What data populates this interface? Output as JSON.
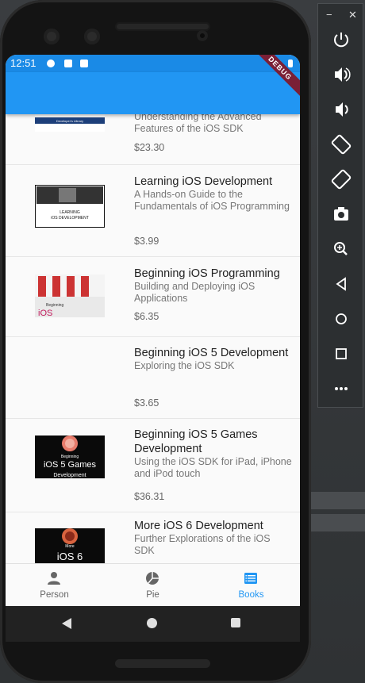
{
  "status": {
    "time": "12:51",
    "debug_label": "DEBUG"
  },
  "books": [
    {
      "title": "",
      "subtitle": "Understanding the Advanced Features of the iOS SDK",
      "price": "$23.30"
    },
    {
      "title": "Learning iOS Development",
      "subtitle": "A Hands-on Guide to the Fundamentals of iOS Programming",
      "price": "$3.99"
    },
    {
      "title": "Beginning iOS Programming",
      "subtitle": "Building and Deploying iOS Applications",
      "price": "$6.35"
    },
    {
      "title": "Beginning iOS 5 Development",
      "subtitle": "Exploring the iOS SDK",
      "price": "$3.65"
    },
    {
      "title": "Beginning iOS 5 Games Development",
      "subtitle": "Using the iOS SDK for iPad, iPhone and iPod touch",
      "price": "$36.31"
    },
    {
      "title": "More iOS 6 Development",
      "subtitle": "Further Explorations of the iOS SDK",
      "price": ""
    }
  ],
  "nav": {
    "person": "Person",
    "pie": "Pie",
    "books": "Books"
  },
  "colors": {
    "primary": "#2196f3",
    "statusbar": "#1a8ae6"
  },
  "toolbar": {
    "minimize": "−",
    "close": "✕",
    "icons": [
      "power-icon",
      "volume-up-icon",
      "volume-down-icon",
      "rotate-left-icon",
      "rotate-right-icon",
      "camera-icon",
      "zoom-icon",
      "back-icon",
      "home-icon",
      "overview-icon",
      "more-icon"
    ]
  }
}
